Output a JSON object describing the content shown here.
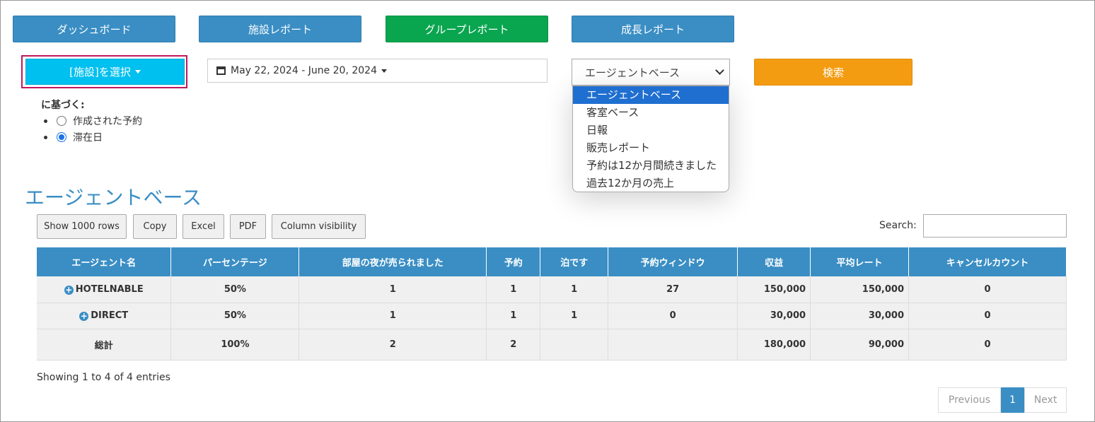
{
  "nav": {
    "dashboard": "ダッシュボード",
    "facility_report": "施設レポート",
    "group_report": "グループレポート",
    "growth_report": "成長レポート"
  },
  "filters": {
    "facility_select": "[施設]を選択",
    "date_range": "May 22, 2024 - June 20, 2024",
    "report_type_selected": "エージェントベース",
    "search_button": "検索",
    "report_type_options": [
      "エージェントベース",
      "客室ベース",
      "日報",
      "販売レポート",
      "予約は12か月間続きました",
      "過去12か月の売上"
    ]
  },
  "based_on": {
    "label": "に基づく:",
    "options": [
      "作成された予約",
      "滞在日"
    ],
    "selected": "滞在日"
  },
  "section_title": "エージェントベース",
  "table_buttons": {
    "show_rows": "Show 1000 rows",
    "copy": "Copy",
    "excel": "Excel",
    "pdf": "PDF",
    "column_visibility": "Column visibility"
  },
  "search": {
    "label": "Search:",
    "value": ""
  },
  "table": {
    "columns": [
      "エージェント名",
      "パーセンテージ",
      "部屋の夜が売られました",
      "予約",
      "泊です",
      "予約ウィンドウ",
      "収益",
      "平均レート",
      "キャンセルカウント"
    ],
    "rows": [
      [
        "HOTELNABLE",
        "50%",
        "1",
        "1",
        "1",
        "27",
        "150,000",
        "150,000",
        "0"
      ],
      [
        "DIRECT",
        "50%",
        "1",
        "1",
        "1",
        "0",
        "30,000",
        "30,000",
        "0"
      ]
    ],
    "total": [
      "総計",
      "100%",
      "2",
      "2",
      "",
      "",
      "180,000",
      "90,000",
      "0"
    ]
  },
  "footer": {
    "info": "Showing 1 to 4 of 4 entries",
    "prev": "Previous",
    "page": "1",
    "next": "Next"
  },
  "colors": {
    "primary": "#3a8ec4",
    "success": "#0aa54f",
    "info": "#00c0ef",
    "warning": "#f39c12",
    "highlight_border": "#c0175d",
    "dropdown_active": "#1f6fd0"
  }
}
